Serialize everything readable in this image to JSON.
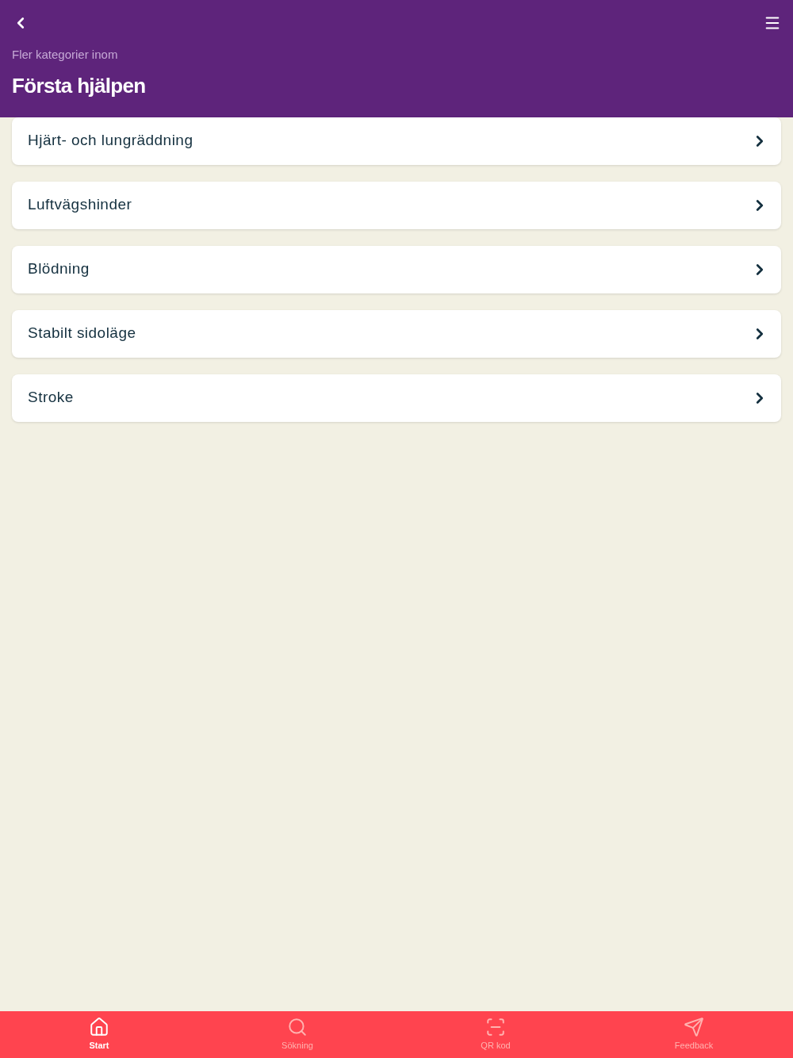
{
  "header": {
    "subtitle": "Fler kategorier inom",
    "title": "Första hjälpen"
  },
  "items": [
    {
      "label": "Hjärt- och lungräddning"
    },
    {
      "label": "Luftvägshinder"
    },
    {
      "label": "Blödning"
    },
    {
      "label": "Stabilt sidoläge"
    },
    {
      "label": "Stroke"
    }
  ],
  "tabs": [
    {
      "kind": "home",
      "label": "Start",
      "selected": true
    },
    {
      "kind": "search",
      "label": "Sökning",
      "selected": false
    },
    {
      "kind": "scan",
      "label": "QR kod",
      "selected": false
    },
    {
      "kind": "send",
      "label": "Feedback",
      "selected": false
    }
  ]
}
